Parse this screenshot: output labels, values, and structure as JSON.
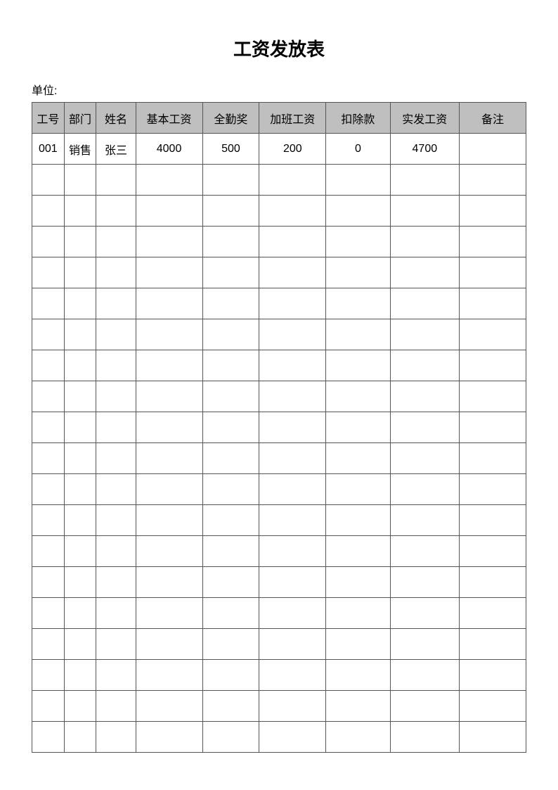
{
  "title": "工资发放表",
  "unit_label": "单位:",
  "headers": [
    "工号",
    "部门",
    "姓名",
    "基本工资",
    "全勤奖",
    "加班工资",
    "扣除款",
    "实发工资",
    "备注"
  ],
  "rows": [
    [
      "001",
      "销售",
      "张三",
      "4000",
      "500",
      "200",
      "0",
      "4700",
      ""
    ],
    [
      "",
      "",
      "",
      "",
      "",
      "",
      "",
      "",
      ""
    ],
    [
      "",
      "",
      "",
      "",
      "",
      "",
      "",
      "",
      ""
    ],
    [
      "",
      "",
      "",
      "",
      "",
      "",
      "",
      "",
      ""
    ],
    [
      "",
      "",
      "",
      "",
      "",
      "",
      "",
      "",
      ""
    ],
    [
      "",
      "",
      "",
      "",
      "",
      "",
      "",
      "",
      ""
    ],
    [
      "",
      "",
      "",
      "",
      "",
      "",
      "",
      "",
      ""
    ],
    [
      "",
      "",
      "",
      "",
      "",
      "",
      "",
      "",
      ""
    ],
    [
      "",
      "",
      "",
      "",
      "",
      "",
      "",
      "",
      ""
    ],
    [
      "",
      "",
      "",
      "",
      "",
      "",
      "",
      "",
      ""
    ],
    [
      "",
      "",
      "",
      "",
      "",
      "",
      "",
      "",
      ""
    ],
    [
      "",
      "",
      "",
      "",
      "",
      "",
      "",
      "",
      ""
    ],
    [
      "",
      "",
      "",
      "",
      "",
      "",
      "",
      "",
      ""
    ],
    [
      "",
      "",
      "",
      "",
      "",
      "",
      "",
      "",
      ""
    ],
    [
      "",
      "",
      "",
      "",
      "",
      "",
      "",
      "",
      ""
    ],
    [
      "",
      "",
      "",
      "",
      "",
      "",
      "",
      "",
      ""
    ],
    [
      "",
      "",
      "",
      "",
      "",
      "",
      "",
      "",
      ""
    ],
    [
      "",
      "",
      "",
      "",
      "",
      "",
      "",
      "",
      ""
    ],
    [
      "",
      "",
      "",
      "",
      "",
      "",
      "",
      "",
      ""
    ],
    [
      "",
      "",
      "",
      "",
      "",
      "",
      "",
      "",
      ""
    ]
  ]
}
